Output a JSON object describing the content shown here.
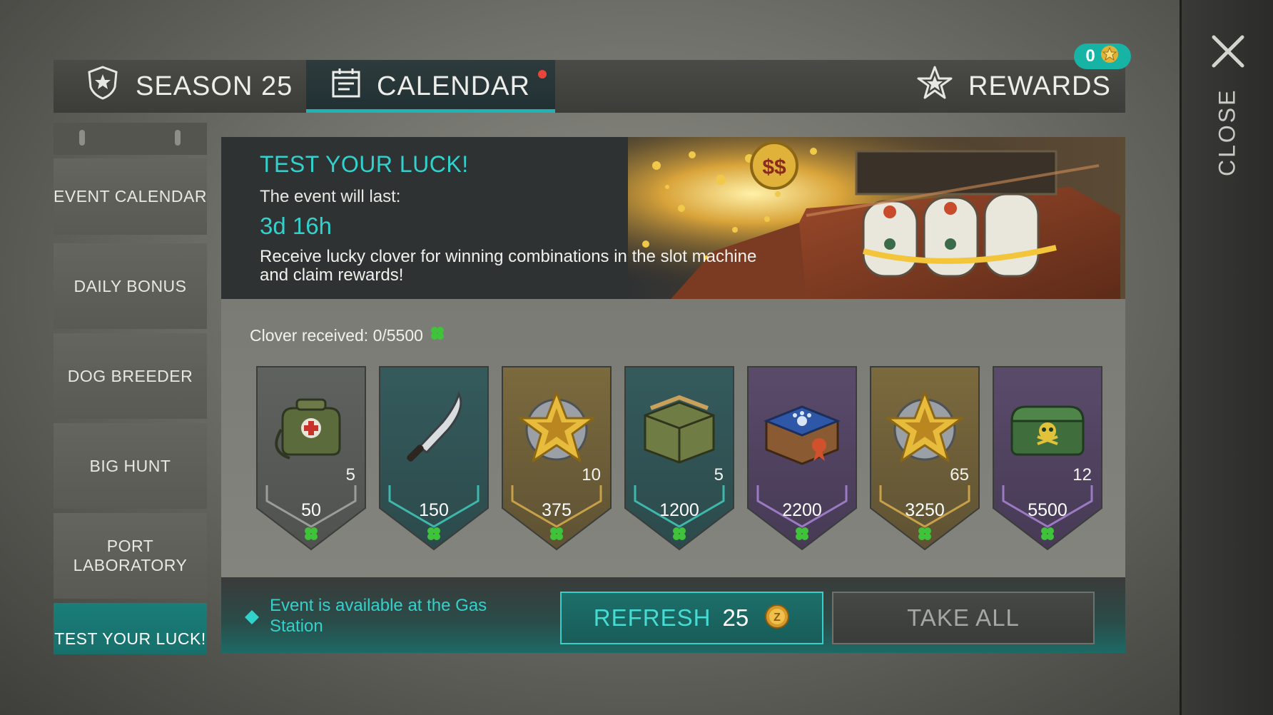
{
  "tabs": {
    "season": "SEASON 25",
    "calendar": "CALENDAR",
    "rewards": "REWARDS",
    "rewards_badge": "0"
  },
  "close_label": "CLOSE",
  "sidebar": {
    "items": [
      {
        "label": "EVENT CALENDAR"
      },
      {
        "label": "DAILY BONUS"
      },
      {
        "label": "DOG BREEDER"
      },
      {
        "label": "BIG HUNT"
      },
      {
        "label": "PORT LABORATORY"
      },
      {
        "label": "TEST YOUR LUCK!"
      }
    ]
  },
  "event": {
    "title": "TEST YOUR LUCK!",
    "duration_label": "The event will last:",
    "timer": "3d 16h",
    "description": "Receive lucky clover for winning combinations in the slot machine and claim rewards!"
  },
  "progress": {
    "label": "Clover received: 0/5500"
  },
  "milestones": [
    {
      "threshold": "50",
      "quantity": "5",
      "item_icon": "medkit-bag-icon",
      "theme": "gray"
    },
    {
      "threshold": "150",
      "quantity": "",
      "item_icon": "machete-icon",
      "theme": "teal"
    },
    {
      "threshold": "375",
      "quantity": "10",
      "item_icon": "gold-star-token-icon",
      "theme": "gold"
    },
    {
      "threshold": "1200",
      "quantity": "5",
      "item_icon": "wooden-crate-icon",
      "theme": "teal"
    },
    {
      "threshold": "2200",
      "quantity": "",
      "item_icon": "dog-crate-icon",
      "theme": "purple"
    },
    {
      "threshold": "3250",
      "quantity": "65",
      "item_icon": "gold-star-token-icon",
      "theme": "gold"
    },
    {
      "threshold": "5500",
      "quantity": "12",
      "item_icon": "toxic-chest-icon",
      "theme": "purple"
    }
  ],
  "footer": {
    "availability": "Event is available at the Gas Station",
    "refresh_label": "REFRESH",
    "refresh_cost": "25",
    "take_all_label": "TAKE ALL"
  },
  "colors": {
    "accent": "#33d1cc",
    "notification_dot": "#e8453c",
    "clover": "#3fc33a"
  }
}
